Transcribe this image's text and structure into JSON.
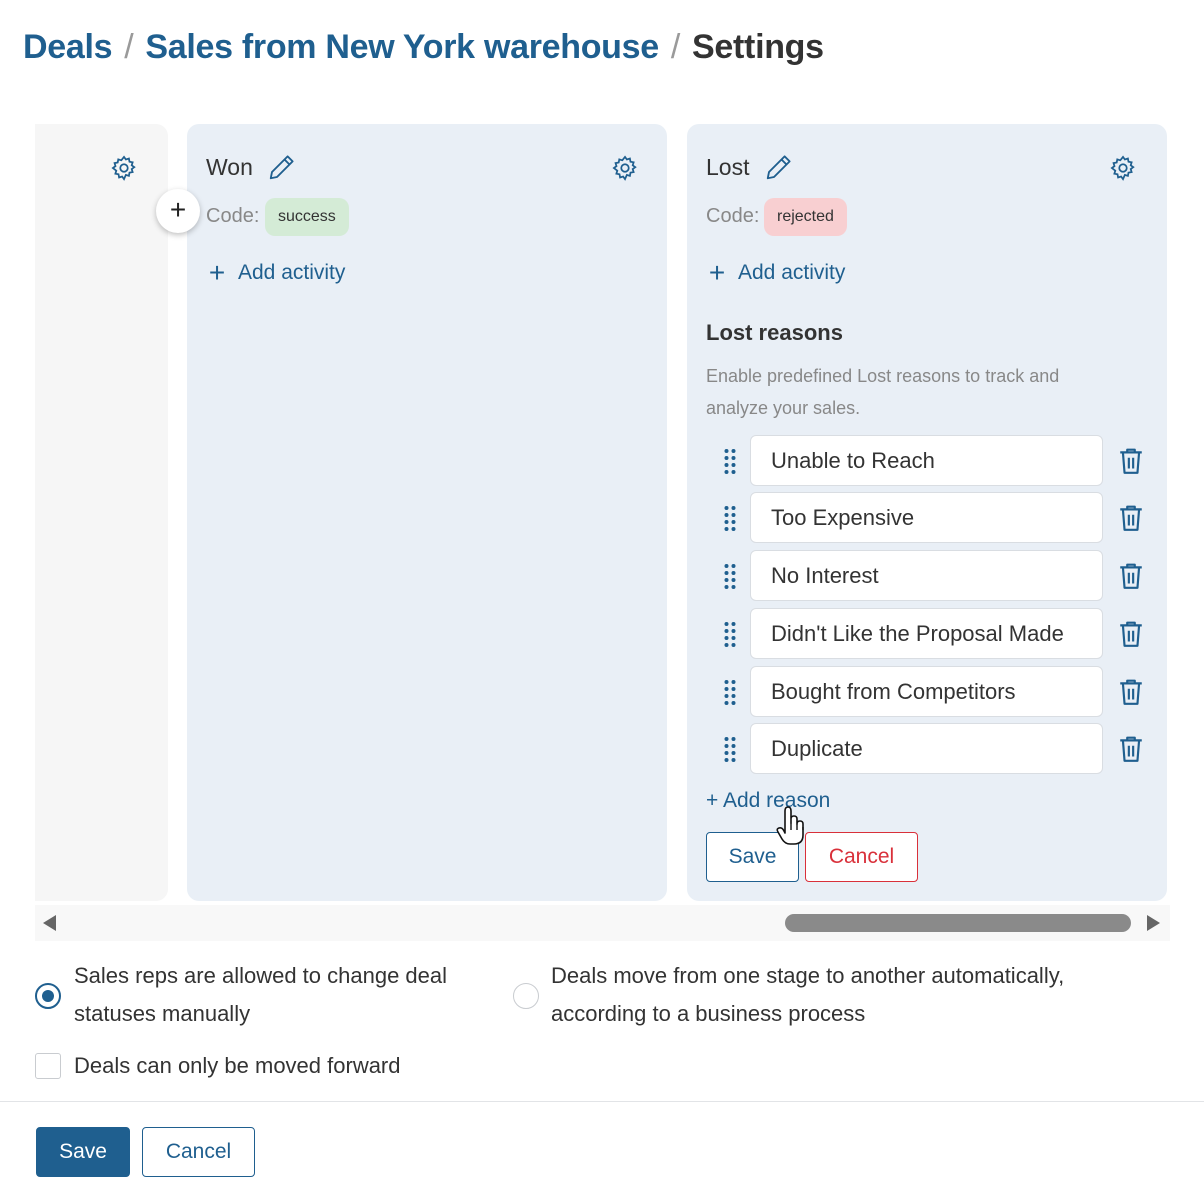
{
  "breadcrumb": {
    "items": [
      "Deals",
      "Sales from New York warehouse",
      "Settings"
    ],
    "separator": "/"
  },
  "stages": {
    "won": {
      "title": "Won",
      "code_label": "Code:",
      "code": "success",
      "add_activity": "Add activity"
    },
    "lost": {
      "title": "Lost",
      "code_label": "Code:",
      "code": "rejected",
      "add_activity": "Add activity",
      "reasons_title": "Lost reasons",
      "reasons_description": "Enable predefined Lost reasons to track and analyze your sales.",
      "reasons": [
        "Unable to Reach",
        "Too Expensive",
        "No Interest",
        "Didn't Like the Proposal Made",
        "Bought from Competitors",
        "Duplicate"
      ],
      "add_reason": "+ Add reason",
      "save": "Save",
      "cancel": "Cancel"
    }
  },
  "add_stage_symbol": "+",
  "options": {
    "manual": "Sales reps are allowed to change deal statuses manually",
    "manual_selected": true,
    "automatic": "Deals move from one stage to another automatically, according to a business process",
    "automatic_selected": false,
    "forward_only": "Deals can only be moved forward",
    "forward_only_checked": false
  },
  "footer": {
    "save": "Save",
    "cancel": "Cancel"
  },
  "colors": {
    "accent": "#1f5f8f",
    "danger": "#d9303a",
    "column_bg": "#e9eff6",
    "success_badge": "#d4ebd6",
    "rejected_badge": "#f8cfd1"
  },
  "icons": {
    "settings": "gear-icon",
    "edit": "pencil-icon",
    "delete": "trash-icon",
    "drag": "drag-handle-icon"
  }
}
